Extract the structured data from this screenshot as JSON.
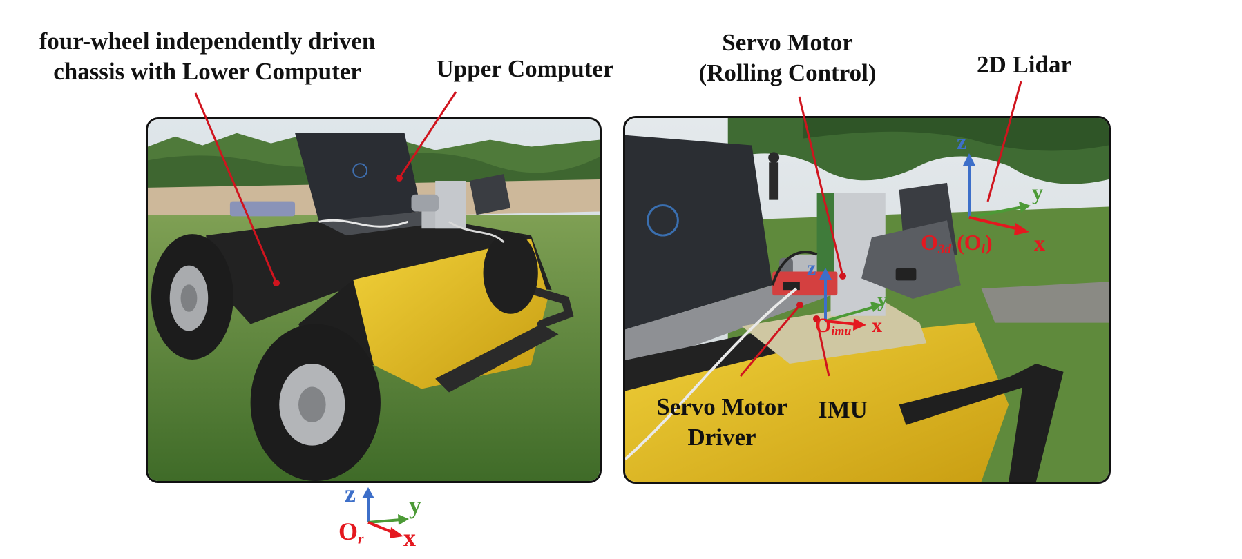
{
  "labels": {
    "chassis_line1": "four-wheel independently driven",
    "chassis_line2": "chassis with Lower Computer",
    "upper_computer": "Upper Computer",
    "servo_motor_line1": "Servo Motor",
    "servo_motor_line2": "(Rolling Control)",
    "lidar": "2D Lidar",
    "servo_driver_line1": "Servo Motor",
    "servo_driver_line2": "Driver",
    "imu": "IMU"
  },
  "robot_frame": {
    "z": "z",
    "y": "y",
    "x": "x",
    "origin": "O",
    "origin_sub": "r"
  },
  "lidar_frame": {
    "z": "z",
    "y": "y",
    "x": "x",
    "origin": "O",
    "origin_sub": "3d",
    "alt_origin": "(O",
    "alt_origin_sub": "l",
    "alt_close": ")"
  },
  "imu_frame": {
    "z": "z",
    "y": "y",
    "x": "x",
    "origin": "O",
    "origin_sub": "imu"
  },
  "colors": {
    "leader": "#d0141e",
    "axis_x": "#e4181f",
    "axis_y": "#4c9a36",
    "axis_z": "#3d6fc9",
    "chassis_yellow": "#e9c21f",
    "tire": "#1c1c1c",
    "grass": "#5f8a3c"
  }
}
